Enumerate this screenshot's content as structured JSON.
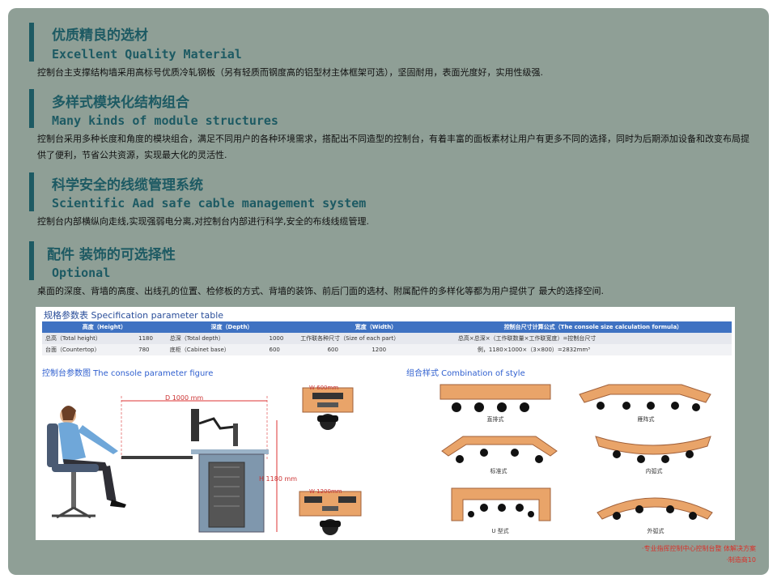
{
  "sections": [
    {
      "title_cn": "优质精良的选材",
      "title_en": "Excellent Quality Material",
      "body": "控制台主支撑结构墙采用高标号优质冷轧钢板（另有轻质而钢度高的铝型材主体框架可选），坚固耐用，表面光度好，实用性级强."
    },
    {
      "title_cn": "多样式模块化结构组合",
      "title_en": "Many kinds of module structures",
      "body": "控制台采用多种长度和角度的模块组合，满足不同用户的各种环境需求，搭配出不同造型的控制台，有着丰富的面板素材让用户有更多不同的选择，同时为后期添加设备和改变布局提供了便利，节省公共资源，实现最大化的灵活性."
    },
    {
      "title_cn": "科学安全的线缆管理系统",
      "title_en": "Scientific Aad safe cable management system",
      "body": "控制台内部横纵向走线,实现强弱电分离,对控制台内部进行科学,安全的布线线缆管理."
    },
    {
      "title_cn": "配件 装饰的可选择性",
      "title_en": "Optional",
      "body": "桌面的深度、背墙的高度、出线孔的位置、检修板的方式、背墙的装饰、前后门面的选材、附属配件的多样化等都为用户提供了 最大的选择空间."
    }
  ],
  "spec": {
    "title": "规格参数表  Specification parameter table",
    "headers": [
      "高度（Height）",
      "深度（Depth）",
      "宽度（Width）",
      "控制台尺寸计算公式（The console size calculation formula）"
    ],
    "row1": {
      "h_label": "总高（Total height）",
      "h_val": "1180",
      "d_label": "总深（Total depth）",
      "d_val": "1000",
      "w_label": "工作联各种尺寸（Size of each part）",
      "formula": "总高×总深×（工作联数量×工作联宽度）=控制台尺寸"
    },
    "row2": {
      "h_label": "台面（Countertop）",
      "h_val": "780",
      "d_label": "底柜（Cabinet base）",
      "d_val": "600",
      "w_val1": "600",
      "w_val2": "1200",
      "formula": "例，1180×1000×（3×800）=2832mm³"
    },
    "figure_title": "控制台参数图  The console parameter figure",
    "combo_title": "组合样式  Combination of style",
    "dims": {
      "depth": "D 1000 mm",
      "height": "H 1180 mm",
      "w600": "W 600mm",
      "w1200": "W 1200mm"
    },
    "combos": [
      "直排式",
      "雁阵式",
      "标准式",
      "内弧式",
      "U 型式",
      "外弧式"
    ]
  },
  "footer": {
    "line1": "·专业指挥控制中心控制台整 体解决方案",
    "line2": "·制造商10"
  },
  "colors": {
    "panel": "#8f9f96",
    "title": "#1d5a63",
    "table_header": "#3f72c2",
    "accent_red": "#d9322a",
    "desk_orange": "#e9a469"
  }
}
